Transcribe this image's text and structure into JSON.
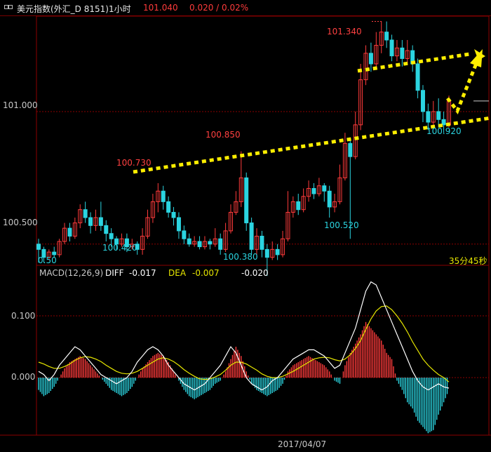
{
  "header": {
    "title": "美元指数(外汇_D 8151)1小时",
    "price": "101.040",
    "change": "0.020 / 0.02%"
  },
  "price_axis": {
    "ticks": [
      "101.000",
      "100.500"
    ]
  },
  "annotations": {
    "high": "101.340",
    "peak1": "100.850",
    "peak0": "100.730",
    "low1": "100.420",
    "low2": "100.380",
    "low3": "100.520",
    "low4": "100.920",
    "bottom_left": "0.50",
    "countdown": "35分45秒"
  },
  "macd": {
    "name": "MACD(12,26,9)",
    "diff_label": "DIFF",
    "diff_value": "-0.017",
    "dea_label": "DEA",
    "dea_value": "-0.007",
    "macd_value": "-0.020",
    "ticks": [
      "0.100",
      "0.000"
    ]
  },
  "footer": {
    "date": "2017/04/07"
  },
  "colors": {
    "bg": "#000000",
    "up": "#ff3b3b",
    "down": "#2bd4e0",
    "grid": "#8b0000",
    "trend": "#ffee00",
    "diff": "#ffffff",
    "dea": "#e6e600",
    "axis": "#c0c0c0"
  },
  "chart_data": {
    "type": "candlestick",
    "ylim": [
      100.42,
      101.36
    ],
    "candles": [
      [
        100.5,
        100.48,
        100.52,
        100.43
      ],
      [
        100.48,
        100.45,
        100.49,
        100.43
      ],
      [
        100.45,
        100.47,
        100.48,
        100.44
      ],
      [
        100.47,
        100.46,
        100.49,
        100.45
      ],
      [
        100.46,
        100.51,
        100.52,
        100.45
      ],
      [
        100.51,
        100.56,
        100.58,
        100.5
      ],
      [
        100.56,
        100.53,
        100.58,
        100.51
      ],
      [
        100.53,
        100.58,
        100.6,
        100.52
      ],
      [
        100.58,
        100.63,
        100.65,
        100.56
      ],
      [
        100.63,
        100.6,
        100.66,
        100.58
      ],
      [
        100.6,
        100.57,
        100.62,
        100.54
      ],
      [
        100.57,
        100.6,
        100.63,
        100.55
      ],
      [
        100.6,
        100.57,
        100.66,
        100.55
      ],
      [
        100.57,
        100.54,
        100.59,
        100.51
      ],
      [
        100.54,
        100.52,
        100.56,
        100.49
      ],
      [
        100.52,
        100.5,
        100.53,
        100.48
      ],
      [
        100.5,
        100.52,
        100.54,
        100.49
      ],
      [
        100.52,
        100.49,
        100.54,
        100.47
      ],
      [
        100.49,
        100.5,
        100.52,
        100.48
      ],
      [
        100.5,
        100.48,
        100.51,
        100.46
      ],
      [
        100.48,
        100.53,
        100.56,
        100.46
      ],
      [
        100.53,
        100.6,
        100.63,
        100.52
      ],
      [
        100.6,
        100.66,
        100.69,
        100.58
      ],
      [
        100.66,
        100.7,
        100.73,
        100.62
      ],
      [
        100.7,
        100.66,
        100.72,
        100.63
      ],
      [
        100.66,
        100.62,
        100.68,
        100.6
      ],
      [
        100.62,
        100.6,
        100.64,
        100.57
      ],
      [
        100.6,
        100.55,
        100.62,
        100.52
      ],
      [
        100.55,
        100.52,
        100.57,
        100.5
      ],
      [
        100.52,
        100.5,
        100.54,
        100.49
      ],
      [
        100.5,
        100.51,
        100.53,
        100.49
      ],
      [
        100.51,
        100.49,
        100.53,
        100.48
      ],
      [
        100.49,
        100.51,
        100.53,
        100.48
      ],
      [
        100.51,
        100.5,
        100.52,
        100.48
      ],
      [
        100.5,
        100.52,
        100.56,
        100.49
      ],
      [
        100.52,
        100.48,
        100.54,
        100.46
      ],
      [
        100.48,
        100.55,
        100.58,
        100.47
      ],
      [
        100.55,
        100.62,
        100.65,
        100.54
      ],
      [
        100.62,
        100.66,
        100.7,
        100.61
      ],
      [
        100.66,
        100.75,
        100.85,
        100.64
      ],
      [
        100.75,
        100.58,
        100.77,
        100.55
      ],
      [
        100.58,
        100.48,
        100.6,
        100.46
      ],
      [
        100.48,
        100.53,
        100.56,
        100.45
      ],
      [
        100.53,
        100.48,
        100.55,
        100.45
      ],
      [
        100.48,
        100.45,
        100.5,
        100.38
      ],
      [
        100.45,
        100.48,
        100.51,
        100.44
      ],
      [
        100.48,
        100.46,
        100.5,
        100.44
      ],
      [
        100.46,
        100.52,
        100.55,
        100.45
      ],
      [
        100.52,
        100.62,
        100.7,
        100.51
      ],
      [
        100.62,
        100.66,
        100.68,
        100.6
      ],
      [
        100.66,
        100.63,
        100.69,
        100.61
      ],
      [
        100.63,
        100.68,
        100.71,
        100.62
      ],
      [
        100.68,
        100.71,
        100.74,
        100.66
      ],
      [
        100.71,
        100.69,
        100.73,
        100.67
      ],
      [
        100.69,
        100.72,
        100.75,
        100.68
      ],
      [
        100.72,
        100.7,
        100.73,
        100.66
      ],
      [
        100.7,
        100.64,
        100.72,
        100.6
      ],
      [
        100.64,
        100.66,
        100.69,
        100.62
      ],
      [
        100.66,
        100.75,
        100.8,
        100.65
      ],
      [
        100.75,
        100.88,
        100.92,
        100.74
      ],
      [
        100.88,
        100.83,
        100.9,
        100.52
      ],
      [
        100.83,
        100.95,
        101.0,
        100.82
      ],
      [
        100.95,
        101.12,
        101.18,
        100.93
      ],
      [
        101.12,
        101.22,
        101.25,
        101.1
      ],
      [
        101.22,
        101.18,
        101.26,
        101.15
      ],
      [
        101.18,
        101.25,
        101.3,
        101.16
      ],
      [
        101.25,
        101.3,
        101.34,
        101.22
      ],
      [
        101.3,
        101.27,
        101.34,
        101.24
      ],
      [
        101.27,
        101.21,
        101.29,
        101.19
      ],
      [
        101.21,
        101.24,
        101.27,
        101.19
      ],
      [
        101.24,
        101.2,
        101.27,
        101.17
      ],
      [
        101.2,
        101.23,
        101.27,
        101.18
      ],
      [
        101.23,
        101.18,
        101.25,
        101.15
      ],
      [
        101.18,
        101.08,
        101.2,
        101.05
      ],
      [
        101.08,
        101.0,
        101.1,
        100.96
      ],
      [
        101.0,
        100.96,
        101.03,
        100.93
      ],
      [
        100.96,
        101.0,
        101.04,
        100.94
      ],
      [
        101.0,
        100.97,
        101.05,
        100.94
      ],
      [
        100.97,
        100.95,
        101.0,
        100.92
      ],
      [
        100.95,
        101.04,
        101.06,
        100.94
      ]
    ],
    "macd_hist": [
      -0.02,
      -0.03,
      -0.025,
      -0.015,
      0.0,
      0.015,
      0.025,
      0.03,
      0.035,
      0.03,
      0.02,
      0.01,
      0.0,
      -0.01,
      -0.02,
      -0.025,
      -0.03,
      -0.025,
      -0.015,
      0.0,
      0.015,
      0.025,
      0.035,
      0.04,
      0.035,
      0.025,
      0.01,
      -0.005,
      -0.02,
      -0.03,
      -0.035,
      -0.03,
      -0.025,
      -0.02,
      -0.01,
      -0.005,
      0.01,
      0.03,
      0.05,
      0.035,
      0.01,
      -0.01,
      -0.02,
      -0.025,
      -0.03,
      -0.025,
      -0.02,
      -0.01,
      0.01,
      0.02,
      0.025,
      0.03,
      0.035,
      0.03,
      0.025,
      0.02,
      0.01,
      -0.005,
      -0.01,
      0.02,
      0.04,
      0.055,
      0.07,
      0.09,
      0.08,
      0.07,
      0.06,
      0.04,
      0.03,
      -0.005,
      -0.02,
      -0.04,
      -0.05,
      -0.07,
      -0.08,
      -0.09,
      -0.085,
      -0.06,
      -0.04,
      -0.02
    ],
    "diff": [
      0.01,
      0.005,
      -0.005,
      0.005,
      0.02,
      0.03,
      0.04,
      0.05,
      0.045,
      0.035,
      0.025,
      0.015,
      0.005,
      0.0,
      -0.005,
      -0.01,
      -0.005,
      0.0,
      0.01,
      0.025,
      0.035,
      0.045,
      0.05,
      0.045,
      0.035,
      0.02,
      0.01,
      0.0,
      -0.01,
      -0.015,
      -0.02,
      -0.015,
      -0.01,
      0.0,
      0.01,
      0.02,
      0.035,
      0.05,
      0.04,
      0.02,
      0.0,
      -0.01,
      -0.015,
      -0.02,
      -0.015,
      -0.005,
      0.0,
      0.01,
      0.02,
      0.03,
      0.035,
      0.04,
      0.045,
      0.045,
      0.04,
      0.035,
      0.025,
      0.015,
      0.02,
      0.04,
      0.06,
      0.08,
      0.11,
      0.14,
      0.155,
      0.15,
      0.13,
      0.11,
      0.09,
      0.07,
      0.05,
      0.03,
      0.01,
      -0.005,
      -0.015,
      -0.02,
      -0.015,
      -0.01,
      -0.015,
      -0.017
    ],
    "dea": [
      0.025,
      0.022,
      0.018,
      0.015,
      0.015,
      0.018,
      0.022,
      0.028,
      0.032,
      0.034,
      0.033,
      0.03,
      0.026,
      0.02,
      0.015,
      0.01,
      0.007,
      0.006,
      0.007,
      0.01,
      0.015,
      0.02,
      0.025,
      0.03,
      0.032,
      0.03,
      0.026,
      0.02,
      0.013,
      0.007,
      0.002,
      -0.002,
      -0.003,
      -0.002,
      0.001,
      0.005,
      0.012,
      0.02,
      0.025,
      0.025,
      0.022,
      0.017,
      0.012,
      0.006,
      0.002,
      0.0,
      0.0,
      0.002,
      0.006,
      0.01,
      0.015,
      0.02,
      0.025,
      0.03,
      0.032,
      0.033,
      0.032,
      0.029,
      0.027,
      0.03,
      0.037,
      0.047,
      0.06,
      0.078,
      0.095,
      0.108,
      0.115,
      0.116,
      0.11,
      0.1,
      0.088,
      0.074,
      0.058,
      0.044,
      0.03,
      0.02,
      0.012,
      0.005,
      0.0,
      -0.007
    ]
  }
}
